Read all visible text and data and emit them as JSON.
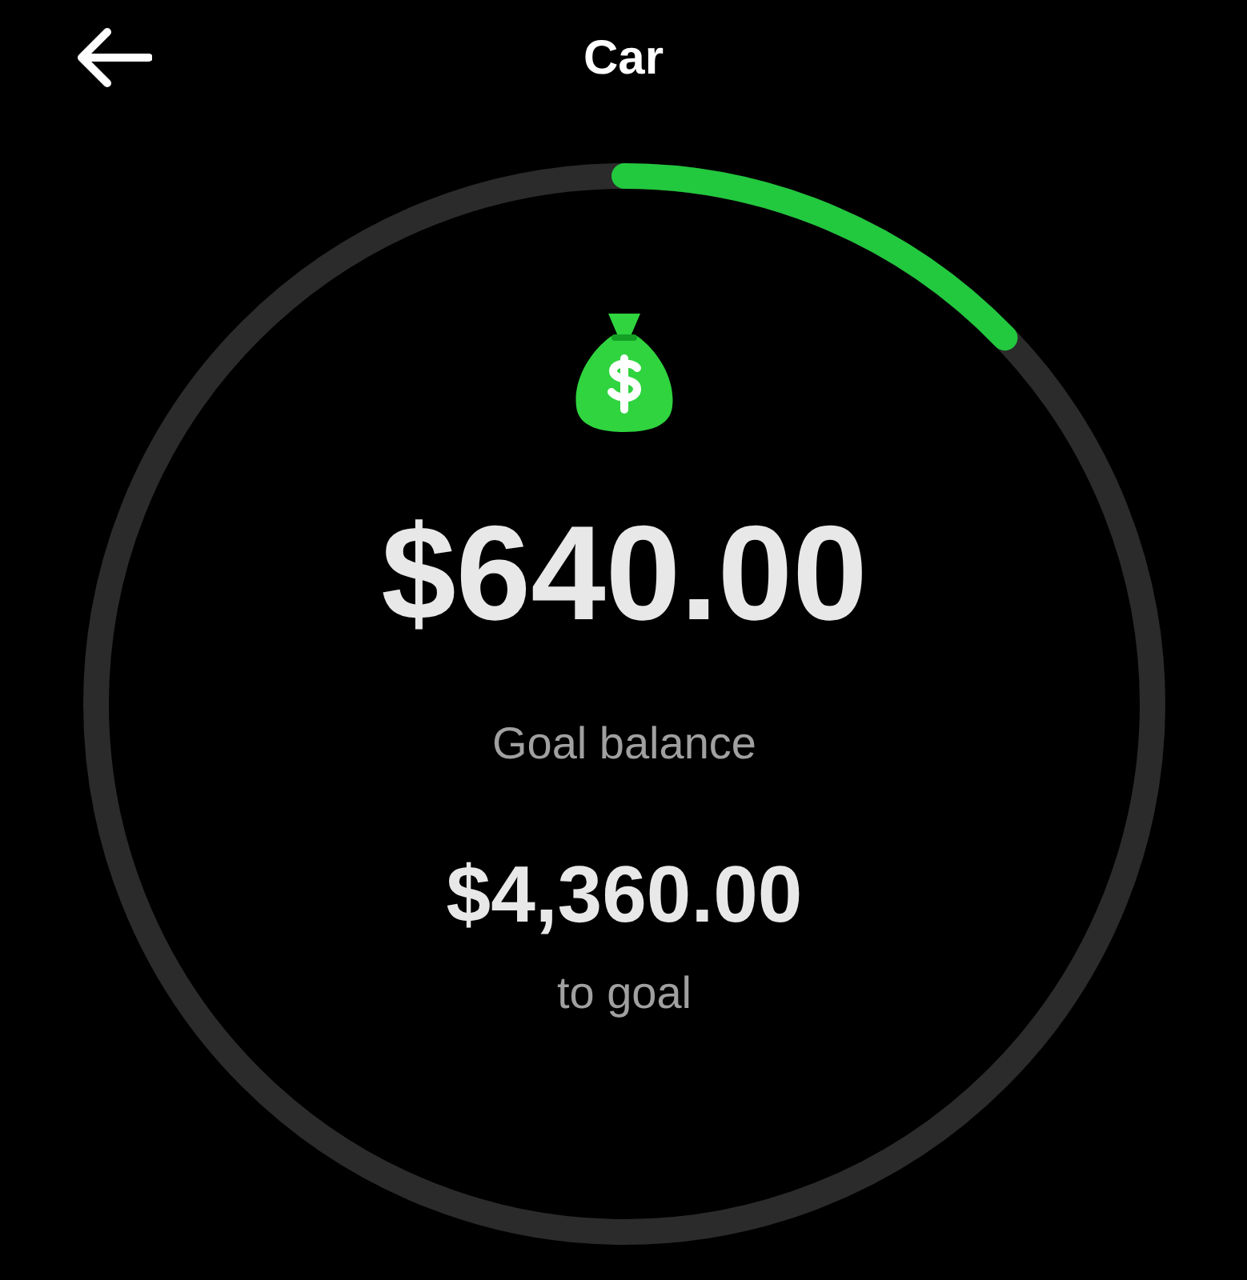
{
  "header": {
    "title": "Car"
  },
  "goal": {
    "balance": "$640.00",
    "balance_label": "Goal balance",
    "remaining": "$4,360.00",
    "remaining_label": "to goal"
  }
}
